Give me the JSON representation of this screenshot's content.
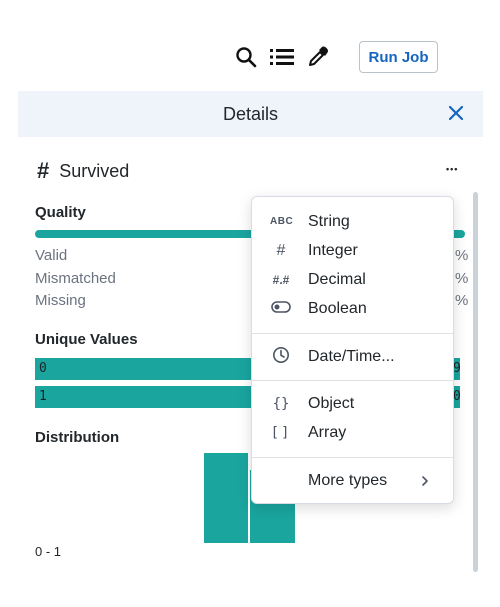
{
  "toolbar": {
    "run_job_label": "Run Job",
    "icons": [
      "search-icon",
      "list-icon",
      "eyedropper-icon"
    ]
  },
  "details": {
    "title": "Details"
  },
  "column": {
    "type_icon": "#",
    "name": "Survived",
    "more_label": "•••"
  },
  "quality": {
    "title": "Quality",
    "rows": [
      {
        "label": "Valid",
        "pct_suffix": "%"
      },
      {
        "label": "Mismatched",
        "pct_suffix": "%"
      },
      {
        "label": "Missing",
        "pct_suffix": "%"
      }
    ],
    "valid_fraction": 1.0
  },
  "unique_values": {
    "title": "Unique Values",
    "rows": [
      {
        "value": "0",
        "count_fragment": "9"
      },
      {
        "value": "1",
        "count_fragment": "0"
      }
    ]
  },
  "distribution": {
    "title": "Distribution",
    "range_label": "0 - 1"
  },
  "type_menu": {
    "items": [
      {
        "icon": "ABC",
        "label": "String"
      },
      {
        "icon": "#",
        "label": "Integer"
      },
      {
        "icon": "#.#",
        "label": "Decimal"
      },
      {
        "icon": "toggle-icon",
        "label": "Boolean"
      },
      {
        "icon": "clock-icon",
        "label": "Date/Time..."
      },
      {
        "icon": "{}",
        "label": "Object"
      },
      {
        "icon": "[]",
        "label": "Array"
      },
      {
        "icon": "chevron-right-icon",
        "label": "More types"
      }
    ]
  },
  "colors": {
    "accent": "#1aa59f",
    "link": "#1565c0",
    "header_bg": "#eef4fa"
  }
}
